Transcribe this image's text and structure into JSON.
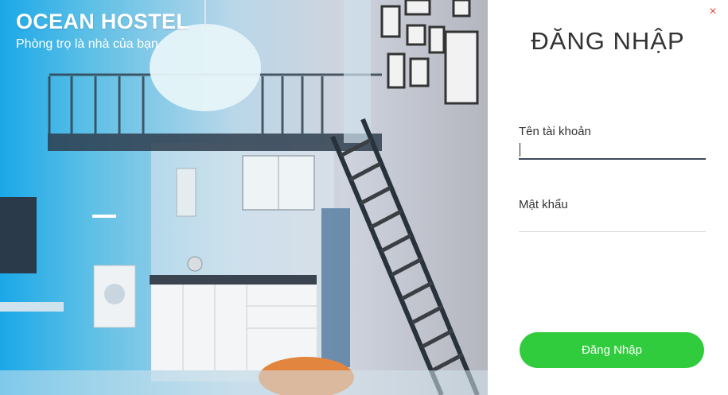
{
  "hero": {
    "brand": "OCEAN HOSTEL",
    "tagline": "Phòng trọ là nhà của bạn"
  },
  "login": {
    "title": "ĐĂNG NHẬP",
    "username_label": "Tên tài khoản",
    "username_value": "",
    "password_label": "Mật khẩu",
    "password_value": "",
    "submit_label": "Đăng Nhập",
    "close_symbol": "×"
  },
  "colors": {
    "accent_green": "#31cc3d",
    "close_red": "#e04b3f",
    "title_text": "#333333"
  }
}
